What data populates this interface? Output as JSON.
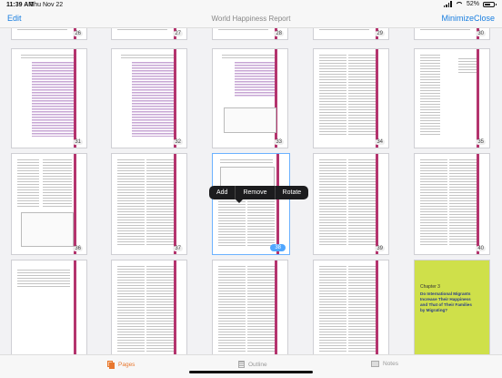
{
  "status": {
    "time": "11:39 AM",
    "date": "Thu Nov 22",
    "battery": "52%"
  },
  "nav": {
    "edit": "Edit",
    "title": "World Happiness Report",
    "minimize": "Minimize",
    "close": "Close"
  },
  "pages": {
    "row0": [
      "26",
      "27",
      "28",
      "29",
      "30"
    ],
    "row1": [
      "31",
      "32",
      "33",
      "34",
      "35"
    ],
    "row2": [
      "36",
      "37",
      "38",
      "39",
      "40"
    ]
  },
  "cover": {
    "chapter": "Chapter 3",
    "heading": "Do International Migrants Increase Their Happiness and That of Their Families by Migrating?"
  },
  "menu": {
    "add": "Add",
    "remove": "Remove",
    "rotate": "Rotate"
  },
  "tabs": {
    "pages": "Pages",
    "outline": "Outline",
    "notes": "Notes"
  },
  "icons": {
    "pages": "pages-icon",
    "outline": "outline-icon",
    "notes": "notes-icon"
  }
}
